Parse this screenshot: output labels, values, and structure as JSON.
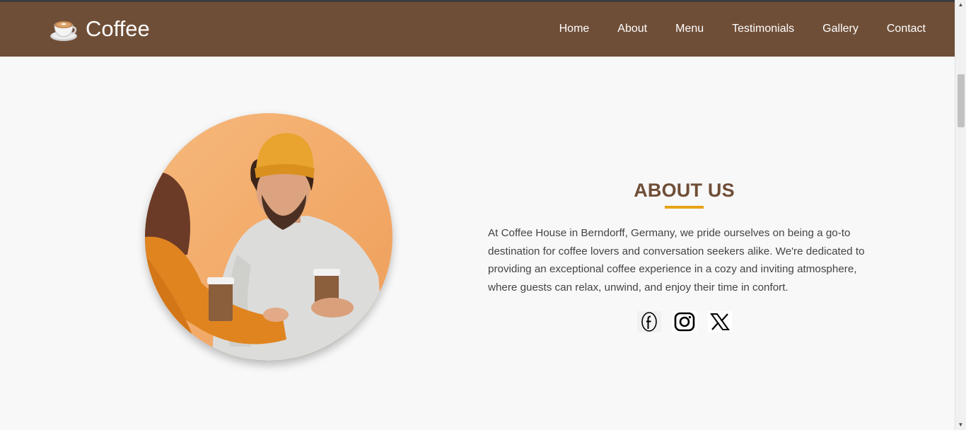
{
  "brand": {
    "name": "Coffee",
    "logo_icon": "coffee-cup-icon"
  },
  "nav": {
    "items": [
      {
        "label": "Home"
      },
      {
        "label": "About"
      },
      {
        "label": "Menu"
      },
      {
        "label": "Testimonials"
      },
      {
        "label": "Gallery"
      },
      {
        "label": "Contact"
      }
    ]
  },
  "about": {
    "title": "ABOUT US",
    "text": "At Coffee House in Berndorff, Germany, we pride ourselves on being a go-to destination for coffee lovers and conversation seekers alike. We're dedicated to providing an exceptional coffee experience in a cozy and inviting atmosphere, where guests can relax, unwind, and enjoy their time in confort."
  },
  "social": [
    {
      "icon": "facebook-icon"
    },
    {
      "icon": "instagram-icon"
    },
    {
      "icon": "x-icon"
    }
  ],
  "colors": {
    "nav_bg": "#6f4e37",
    "accent": "#e8a317",
    "title": "#6f4e37",
    "page_bg": "#f8f8f8"
  }
}
